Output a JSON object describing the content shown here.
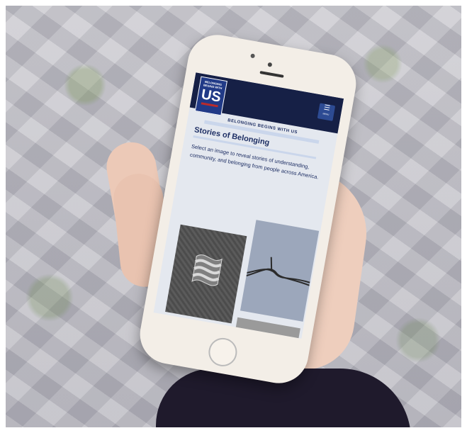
{
  "app": {
    "logo_small": "BELONGING BEGINS WITH",
    "logo_big": "US",
    "menu_label": "MENU",
    "kicker": "BELONGING BEGINS WITH US",
    "title": "Stories of Belonging",
    "intro": "Select an image to reveal stories of understanding, community, and belonging from people across America."
  },
  "icons": {
    "menu": "hamburger-icon"
  },
  "colors": {
    "header": "#15204a",
    "logo": "#1e3a8f",
    "text": "#1c2f6a",
    "accent": "#c62828",
    "screen": "#e4e8f0",
    "phone": "#f4eee6"
  }
}
